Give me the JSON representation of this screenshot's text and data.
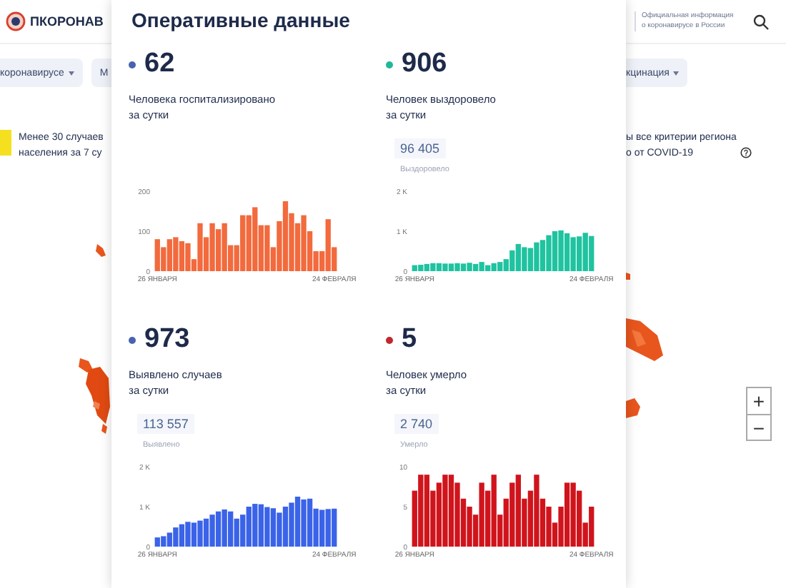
{
  "header": {
    "logo_text": "ПКОРОНАВ",
    "info_lines": [
      "Официальная информация",
      "о коронавирусе в России"
    ]
  },
  "nav": [
    {
      "label": "коронавирусе",
      "caret": true
    },
    {
      "label": "М",
      "caret": false
    },
    {
      "label": "кцинация",
      "caret": true
    }
  ],
  "notice": {
    "lines": [
      "Менее 30 случаев",
      "населения за 7 су"
    ],
    "color": "#f5e020",
    "right_lines": [
      "ы все критерии региона",
      "о от COVID-19"
    ]
  },
  "map_zoom": [
    "+",
    "−"
  ],
  "panel": {
    "title": "Оперативные данные",
    "cards": [
      {
        "value": "62",
        "color": "#4a63b0",
        "label_lines": [
          "Человека госпитализировано",
          "за сутки"
        ],
        "chart_data": {
          "type": "bar",
          "categories": [
            "26 ЯНВАРЯ",
            null,
            null,
            null,
            null,
            null,
            null,
            null,
            null,
            null,
            null,
            null,
            null,
            null,
            null,
            null,
            null,
            null,
            null,
            null,
            null,
            null,
            null,
            null,
            null,
            null,
            null,
            null,
            null,
            "24 ФЕВРАЛЯ"
          ],
          "yticks": [
            0,
            100,
            200
          ],
          "ylim": [
            0,
            200
          ],
          "series": [
            {
              "color": "#f26a3d",
              "values": [
                80,
                60,
                80,
                85,
                75,
                70,
                30,
                120,
                85,
                120,
                105,
                120,
                65,
                65,
                140,
                140,
                160,
                115,
                115,
                60,
                125,
                175,
                145,
                120,
                140,
                100,
                50,
                50,
                130,
                60
              ]
            }
          ]
        }
      },
      {
        "value": "906",
        "color": "#21b89a",
        "label_lines": [
          "Человек выздоровело",
          "за сутки"
        ],
        "total": "96 405",
        "total_label": "Выздоровело",
        "chart_data": {
          "type": "bar",
          "categories": [
            "26 ЯНВАРЯ",
            null,
            null,
            null,
            null,
            null,
            null,
            null,
            null,
            null,
            null,
            null,
            null,
            null,
            null,
            null,
            null,
            null,
            null,
            null,
            null,
            null,
            null,
            null,
            null,
            null,
            null,
            null,
            null,
            "24 ФЕВРАЛЯ"
          ],
          "yticks": [
            {
              "value": 0,
              "label": "0"
            },
            {
              "value": 1000,
              "label": "1 K"
            },
            {
              "value": 2000,
              "label": "2 K"
            }
          ],
          "ylim": [
            0,
            2000
          ],
          "series": [
            {
              "color": "#1fc3a0",
              "values": [
                150,
                160,
                180,
                200,
                200,
                190,
                190,
                200,
                190,
                210,
                180,
                230,
                150,
                200,
                230,
                300,
                520,
                680,
                600,
                580,
                720,
                780,
                900,
                1000,
                1020,
                950,
                850,
                870,
                960,
                880
              ]
            }
          ]
        }
      },
      {
        "value": "973",
        "color": "#4a63b0",
        "label_lines": [
          "Выявлено случаев",
          "за сутки"
        ],
        "total": "113 557",
        "total_label": "Выявлено",
        "chart_data": {
          "type": "bar",
          "categories": [
            "26 ЯНВАРЯ",
            null,
            null,
            null,
            null,
            null,
            null,
            null,
            null,
            null,
            null,
            null,
            null,
            null,
            null,
            null,
            null,
            null,
            null,
            null,
            null,
            null,
            null,
            null,
            null,
            null,
            null,
            null,
            null,
            "24 ФЕВРАЛЯ"
          ],
          "yticks": [
            {
              "value": 0,
              "label": "0"
            },
            {
              "value": 1000,
              "label": "1 K"
            },
            {
              "value": 2000,
              "label": "2 K"
            }
          ],
          "ylim": [
            0,
            2000
          ],
          "series": [
            {
              "color": "#3a63e8",
              "values": [
                230,
                260,
                350,
                480,
                560,
                620,
                600,
                650,
                700,
                800,
                880,
                930,
                880,
                700,
                800,
                1000,
                1070,
                1060,
                990,
                960,
                850,
                1000,
                1100,
                1250,
                1180,
                1200,
                950,
                920,
                940,
                950
              ]
            }
          ]
        }
      },
      {
        "value": "5",
        "color": "#c0282d",
        "label_lines": [
          "Человек умерло",
          "за сутки"
        ],
        "total": "2 740",
        "total_label": "Умерло",
        "chart_data": {
          "type": "bar",
          "categories": [
            "26 ЯНВАРЯ",
            null,
            null,
            null,
            null,
            null,
            null,
            null,
            null,
            null,
            null,
            null,
            null,
            null,
            null,
            null,
            null,
            null,
            null,
            null,
            null,
            null,
            null,
            null,
            null,
            null,
            null,
            null,
            null,
            "24 ФЕВРАЛЯ"
          ],
          "yticks": [
            0,
            5,
            10
          ],
          "ylim": [
            0,
            10
          ],
          "series": [
            {
              "color": "#d0141c",
              "values": [
                7,
                9,
                9,
                7,
                8,
                9,
                9,
                8,
                6,
                5,
                4,
                8,
                7,
                9,
                4,
                6,
                8,
                9,
                6,
                7,
                9,
                6,
                5,
                3,
                5,
                8,
                8,
                7,
                3,
                5
              ]
            }
          ]
        }
      }
    ]
  }
}
